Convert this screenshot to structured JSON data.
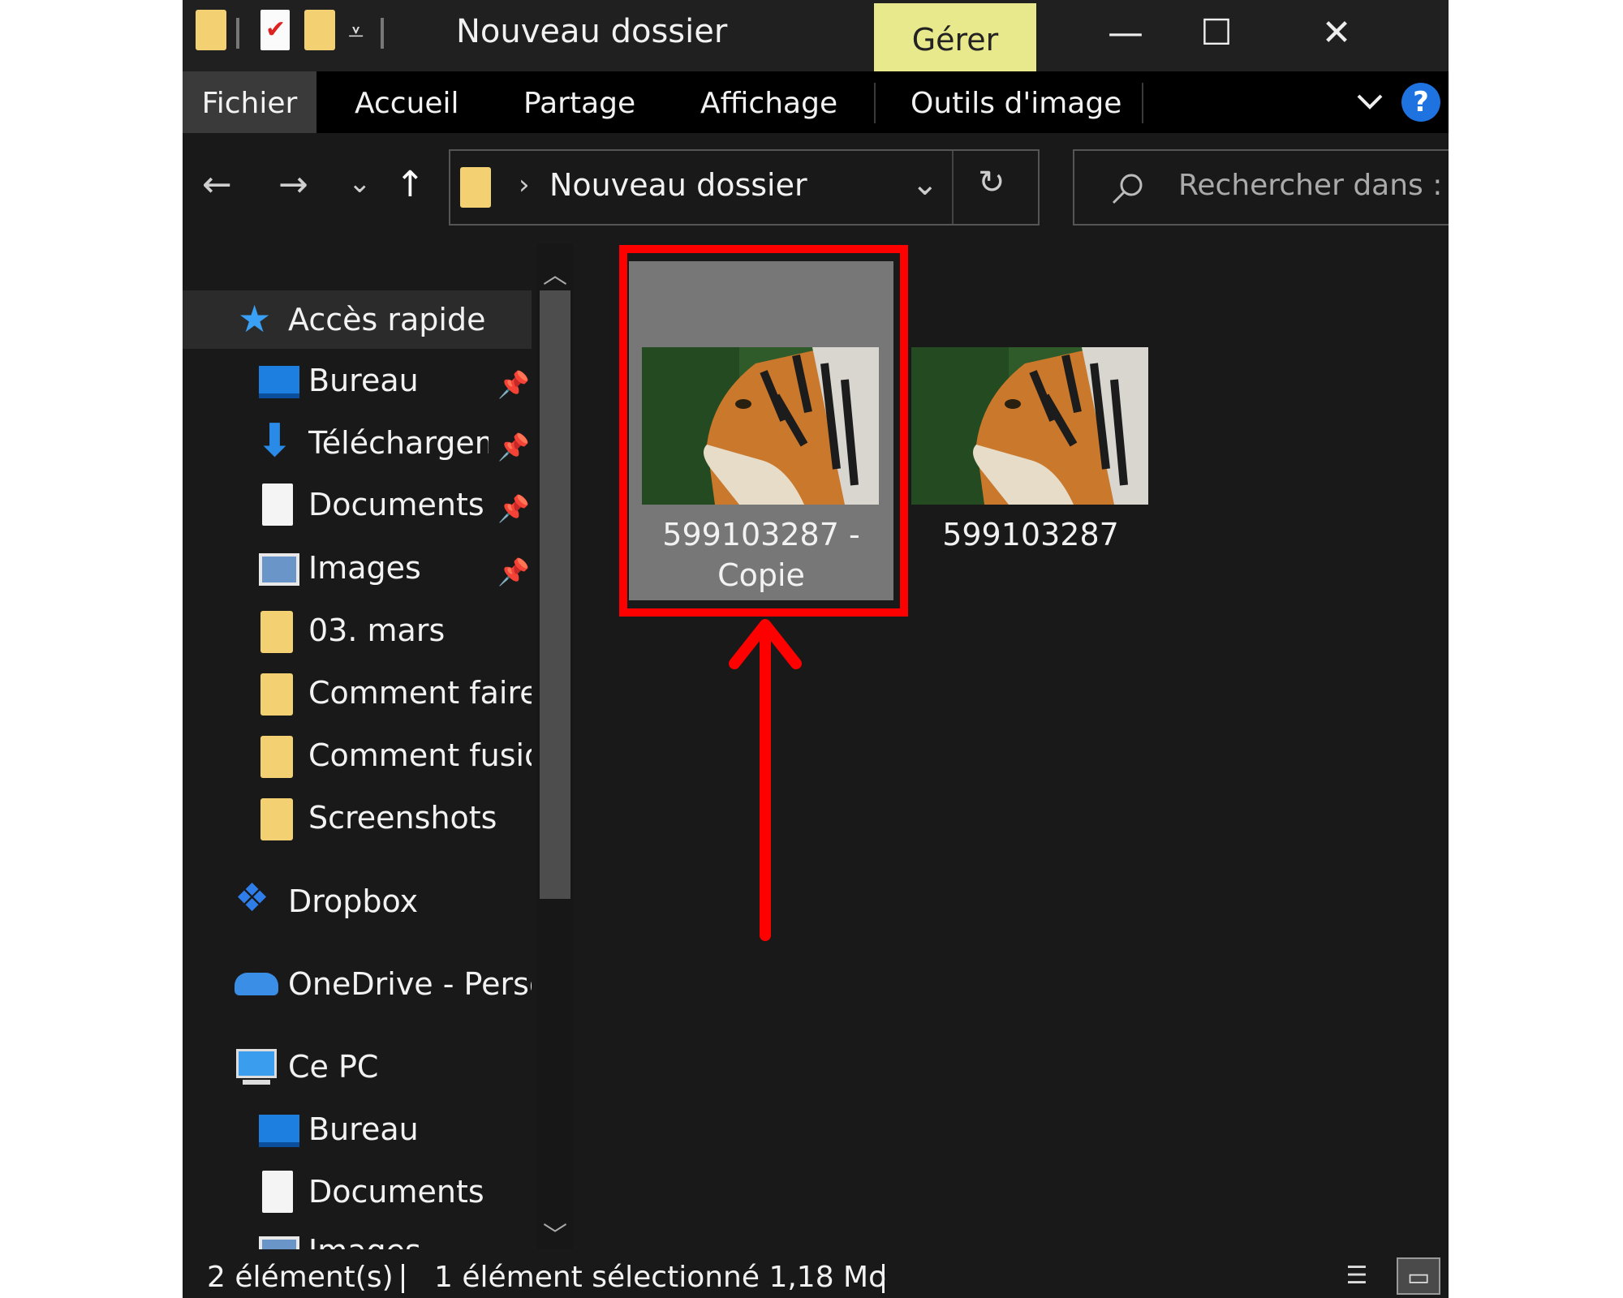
{
  "window": {
    "title": "Nouveau dossier",
    "context_tab": "Gérer",
    "accent_color": "#e8e88c",
    "caption_buttons": {
      "minimize": "—",
      "maximize": "☐",
      "close": "✕"
    }
  },
  "ribbon": {
    "tabs": [
      "Fichier",
      "Accueil",
      "Partage",
      "Affichage",
      "Outils d'image"
    ],
    "expand_icon": "chevron-down-icon",
    "help": "?"
  },
  "navigation": {
    "back": "←",
    "forward": "→",
    "recent": "⌄",
    "up": "↑",
    "address": {
      "separator": "›",
      "path": "Nouveau dossier",
      "dropdown": "⌄",
      "refresh": "↻"
    },
    "search": {
      "icon": "search-icon",
      "placeholder": "Rechercher dans : ..."
    }
  },
  "sidebar": {
    "items": [
      {
        "label": "Accès rapide",
        "icon": "star-icon"
      },
      {
        "label": "Bureau",
        "icon": "desktop-icon",
        "pinned": true
      },
      {
        "label": "Téléchargements",
        "icon": "download-icon",
        "pinned": true
      },
      {
        "label": "Documents",
        "icon": "document-icon",
        "pinned": true
      },
      {
        "label": "Images",
        "icon": "pictures-icon",
        "pinned": true
      },
      {
        "label": "03. mars",
        "icon": "folder-icon"
      },
      {
        "label": "Comment faire d",
        "icon": "folder-icon"
      },
      {
        "label": "Comment fusion",
        "icon": "folder-icon"
      },
      {
        "label": "Screenshots",
        "icon": "folder-icon"
      },
      {
        "label": "Dropbox",
        "icon": "dropbox-icon"
      },
      {
        "label": "OneDrive - Person",
        "icon": "onedrive-icon"
      },
      {
        "label": "Ce PC",
        "icon": "computer-icon"
      },
      {
        "label": "Bureau",
        "icon": "desktop-icon"
      },
      {
        "label": "Documents",
        "icon": "document-icon"
      },
      {
        "label": "Images",
        "icon": "pictures-icon"
      }
    ],
    "pin_glyph": "📌"
  },
  "files": [
    {
      "name": "599103287 - Copie",
      "selected": true,
      "thumbnail": "tiger-photo"
    },
    {
      "name": "599103287",
      "selected": false,
      "thumbnail": "tiger-photo"
    }
  ],
  "status": {
    "count": "2 élément(s)",
    "selection": "1 élément sélectionné  1,18 Mo",
    "views": [
      "details-view-icon",
      "thumbnails-view-icon"
    ]
  },
  "annotation": {
    "color": "#ff0000",
    "target": "599103287 - Copie"
  }
}
